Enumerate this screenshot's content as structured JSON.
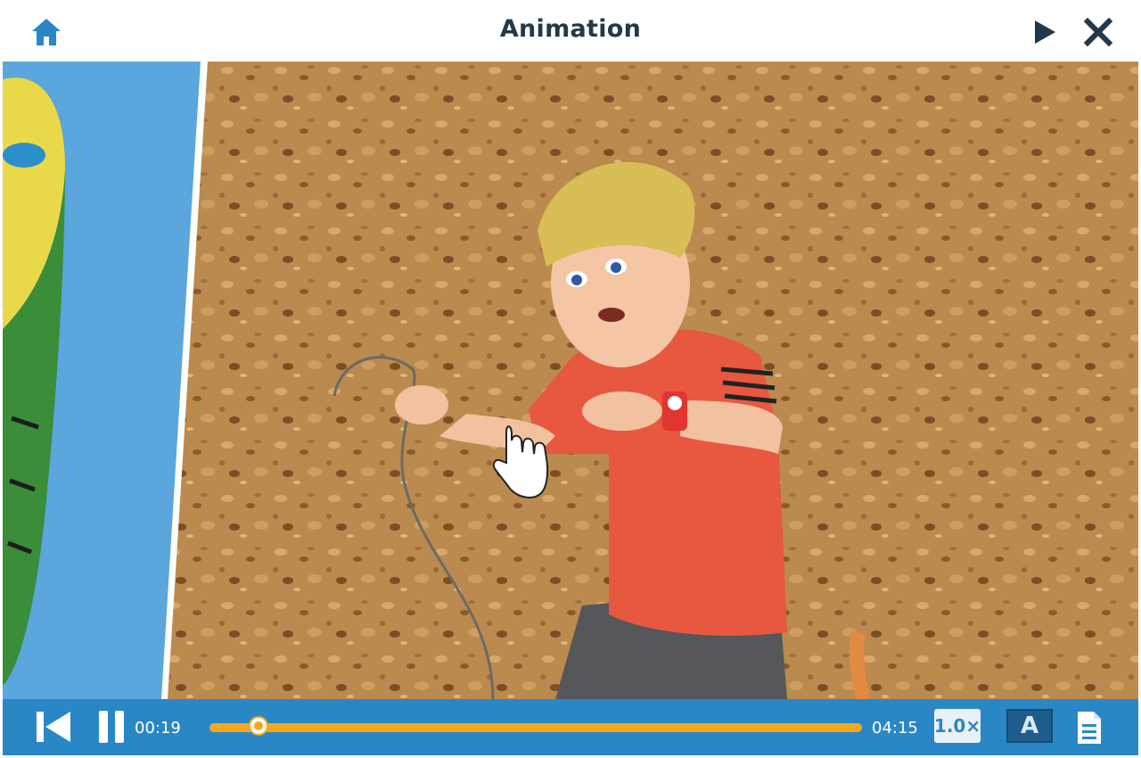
{
  "header": {
    "title": "Animation",
    "home_icon": "home-icon",
    "play_icon": "play-icon",
    "close_icon": "close-icon"
  },
  "player": {
    "current_time": "00:19",
    "total_time": "04:15",
    "progress_fraction": 0.075,
    "speed_label": "1.0×",
    "subtitle_label": "A",
    "transcript_icon": "document-icon",
    "prev_icon": "skip-back-icon",
    "pause_icon": "pause-icon"
  },
  "colors": {
    "accent": "#2a87c6",
    "progress": "#f6a81c",
    "title_text": "#233849",
    "shirt": "#e8573f",
    "cork": "#b98a4e"
  }
}
